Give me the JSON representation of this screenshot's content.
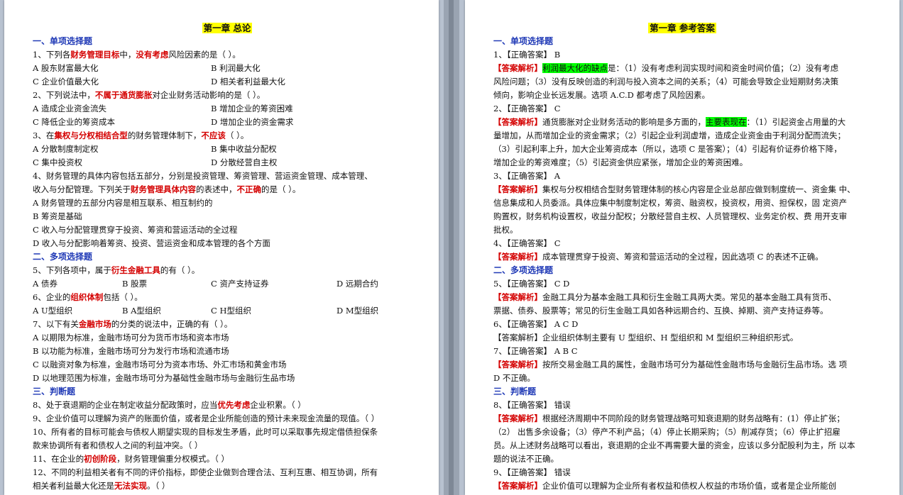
{
  "left": {
    "title": "第一章  总论",
    "sections": {
      "single": "一、单项选择题",
      "multi": "二、多项选择题",
      "judge": "三、判断题"
    },
    "q1": {
      "a": "1、下列各",
      "b": "财务管理目标",
      "c": "中，",
      "d": "没有考虑",
      "e": "风险因素的是（  ）。",
      "o1": "A  股东财富最大化",
      "o2": "B  利润最大化",
      "o3": "C  企业价值最大化",
      "o4": "D  相关者利益最大化"
    },
    "q2": {
      "a": "2、下列说法中，",
      "b": "不属于通货膨胀",
      "c": "对企业财务活动影响的是（   ）。",
      "o1": "A  造成企业资金流失",
      "o2": "B  增加企业的筹资困难",
      "o3": "C  降低企业的筹资成本",
      "o4": "D  增加企业的资金需求"
    },
    "q3": {
      "a": "3、在",
      "b": "集权与分权相结合型",
      "c": "的财务管理体制下，",
      "d": "不应该",
      "e": "（   ）。",
      "o1": "A  分散制度制定权",
      "o2": "B  集中收益分配权",
      "o3": "C  集中投资权",
      "o4": "D  分散经营自主权"
    },
    "q4": {
      "l1": "4、财务管理的具体内容包括五部分，分别是投资管理、筹资管理、营运资金管理、成本管理、",
      "l2a": "收入与分配管理。下列关于",
      "l2b": "财务管理具体内容",
      "l2c": "的表述中，",
      "l2d": "不正确",
      "l2e": "的是（   ）。",
      "o1": "A  财务管理的五部分内容是相互联系、相互制约的",
      "o2": "B  筹资是基础",
      "o3": "C  收入与分配管理贯穿于投资、筹资和营运活动的全过程",
      "o4": "D  收入与分配影响着筹资、投资、营运资金和成本管理的各个方面"
    },
    "q5": {
      "a": "5、下列各项中，属于",
      "b": "衍生金融工具",
      "c": "的有（   ）。",
      "o1": "A  债券",
      "o2": "B  股票",
      "o3": "C  资产支持证券",
      "o4": "D  远期合约"
    },
    "q6": {
      "a": "6、企业的",
      "b": "组织体制",
      "c": "包括（   ）。",
      "o1": "A U型组织",
      "o2": "B A型组织",
      "o3": "C H型组织",
      "o4": "D M型组织"
    },
    "q7": {
      "a": "7、以下有关",
      "b": "金融市场",
      "c": "的分类的说法中，正确的有（   ）。",
      "o1": "A  以期限为标准，金融市场可分为货币市场和资本市场",
      "o2": "B  以功能为标准，金融市场可分为发行市场和流通市场",
      "o3": "C  以融资对象为标准，金融市场可分为资本市场、外汇市场和黄金市场",
      "o4": "D  以地理范围为标准，金融市场可分为基础性金融市场与金融衍生品市场"
    },
    "q8": {
      "a": "8、处于衰退期的企业在制定收益分配政策时，应当",
      "b": "优先考虑",
      "c": "企业积累。（   ）"
    },
    "q9": {
      "text": "9、企业价值可以理解为资产的账面价值，或者是企业所能创造的预计未来现金流量的现值。（   ）"
    },
    "q10": {
      "l1": "10、所有者的目标可能会与债权人期望实现的目标发生矛盾，此时可以采取事先规定借债担保条",
      "l2": "款来协调所有者和债权人之间的利益冲突。（   ）"
    },
    "q11": {
      "a": "11、在企业的",
      "b": "初创阶段",
      "c": "，财务管理偏重分权模式。（   ）"
    },
    "q12": {
      "l1": "12、不同的利益相关者有不同的评价指标，即使企业做到合理合法、互利互惠、相互协调，所有",
      "l2a": "相关者利益最大化还是",
      "l2b": "无法实现",
      "l2c": "。（   ）"
    }
  },
  "right": {
    "title": "第一章   参考答案",
    "sections": {
      "single": "一、单项选择题",
      "multi": "二、多项选择题",
      "judge": "三、判断题"
    },
    "a1": {
      "head": "1、【正确答案】 B",
      "label": "【答案解析】",
      "hl": "利润最大化的缺点",
      "t1": "是：（1）没有考虑利润实现时间和资金时间价值；（2）没有考虑",
      "t2": "风险问题；（3）没有反映创造的利润与投入资本之间的关系；（4）可能会导致企业短期财务决策",
      "t3": "倾向，影响企业长远发展。选项 A.C.D 都考虑了风险因素。"
    },
    "a2": {
      "head": "2、【正确答案】 C",
      "label": "【答案解析】",
      "t1a": "通货膨胀对企业财务活动的影响是多方面的，",
      "hl": "主要表现在",
      "t1b": "：（1）引起资金占用量的大",
      "t2": "量增加，从而增加企业的资金需求；（2）引起企业利润虚增，造成企业资金由于利润分配而流失；",
      "t3": "（3）引起利率上升，加大企业筹资成本（所以，选项 C 是答案）；（4）引起有价证券价格下降，",
      "t4": "增加企业的筹资难度；（5）引起资金供应紧张，增加企业的筹资困难。"
    },
    "a3": {
      "head": "3、【正确答案】 A",
      "label": "【答案解析】",
      "t1": "集权与分权相结合型财务管理体制的核心内容是企业总部应做到制度统一、资金集    中、",
      "t2": "信息集成和人员委派。具体应集中制度制定权，筹资、融资权，投资权，用资、担保权，固     定资产",
      "t3": "购置权，财务机构设置权，收益分配权；分散经营自主权、人员管理权、业务定价权、费     用开支审",
      "t4": "批权。"
    },
    "a4": {
      "head": "4、【正确答案】 C",
      "label": "【答案解析】",
      "t1": "成本管理贯穿于投资、筹资和营运活动的全过程，因此选项 C 的表述不正确。"
    },
    "a5": {
      "head": "5、【正确答案】 C D",
      "label": "【答案解析】",
      "t1": "金融工具分为基本金融工具和衍生金融工具两大类。常见的基本金融工具有货币、",
      "t2": "票据、债券、股票等；常见的衍生金融工具如各种远期合约、互换、掉期、资产支持证券等。"
    },
    "a6": {
      "head": "6、【正确答案】 A C D",
      "t1": "【答案解析】企业组织体制主要有 U 型组织、H 型组织和 M 型组织三种组织形式。"
    },
    "a7": {
      "head": "7、【正确答案】 A B C",
      "label": "【答案解析】",
      "t1": "按所交易金融工具的属性，金融市场可分为基础性金融市场与金融衍生品市场。选     项",
      "t2": "D 不正确。"
    },
    "a8": {
      "head": "8、【正确答案】  错误",
      "label": "【答案解析】",
      "t1": "根据经济周期中不同阶段的财务管理战略可知衰退期的财务战略有：(1）停止扩张；",
      "t2": "（2） 出售多余设备；（3）停产不利产品；（4）停止长期采购；（5）削减存货；（6）停止扩招雇",
      "t3": "员。从上述财务战略可以看出，衰退期的企业不再需要大量的资金，应该以多分配股利为主，所     以本",
      "t4": "题的说法不正确。"
    },
    "a9": {
      "head": "9、【正确答案】  错误",
      "label": "【答案解析】",
      "t1": "企业价值可以理解为企业所有者权益和债权人权益的市场价值，或者是企业所能创"
    }
  }
}
